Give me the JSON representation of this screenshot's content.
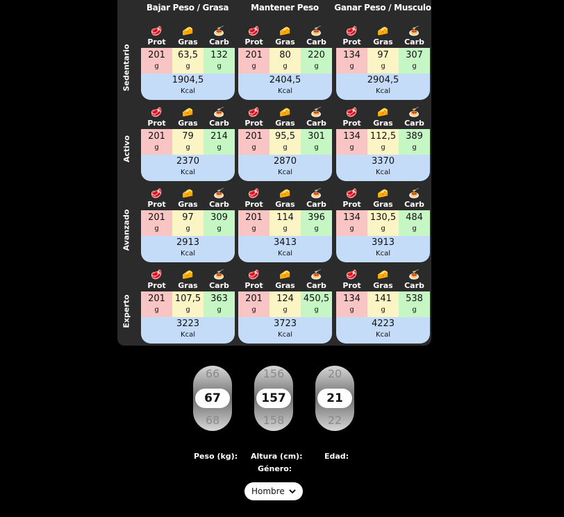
{
  "goals": [
    "Bajar Peso / Grasa",
    "Mantener Peso",
    "Ganar Peso / Musculo"
  ],
  "levels": [
    "Sedentario",
    "Activo",
    "Avanzado",
    "Experto"
  ],
  "macro_labels": {
    "prot": "Prot",
    "fat": "Gras",
    "carb": "Carb"
  },
  "unit_g": "g",
  "unit_kcal": "Kcal",
  "grid": [
    [
      {
        "prot": "201",
        "fat": "63,5",
        "carb": "132",
        "kcal": "1904,5"
      },
      {
        "prot": "201",
        "fat": "80",
        "carb": "220",
        "kcal": "2404,5"
      },
      {
        "prot": "134",
        "fat": "97",
        "carb": "307",
        "kcal": "2904,5"
      }
    ],
    [
      {
        "prot": "201",
        "fat": "79",
        "carb": "214",
        "kcal": "2370"
      },
      {
        "prot": "201",
        "fat": "95,5",
        "carb": "301",
        "kcal": "2870"
      },
      {
        "prot": "134",
        "fat": "112,5",
        "carb": "389",
        "kcal": "3370"
      }
    ],
    [
      {
        "prot": "201",
        "fat": "97",
        "carb": "309",
        "kcal": "2913"
      },
      {
        "prot": "201",
        "fat": "114",
        "carb": "396",
        "kcal": "3413"
      },
      {
        "prot": "134",
        "fat": "130,5",
        "carb": "484",
        "kcal": "3913"
      }
    ],
    [
      {
        "prot": "201",
        "fat": "107,5",
        "carb": "363",
        "kcal": "3223"
      },
      {
        "prot": "201",
        "fat": "124",
        "carb": "450,5",
        "kcal": "3723"
      },
      {
        "prot": "134",
        "fat": "141",
        "carb": "538",
        "kcal": "4223"
      }
    ]
  ],
  "pickers": {
    "weight": {
      "above": "66",
      "value": "67",
      "below": "68",
      "label": "Peso (kg):"
    },
    "height": {
      "above": "156",
      "value": "157",
      "below": "158",
      "label": "Altura (cm):"
    },
    "age": {
      "above": "20",
      "value": "21",
      "below": "22",
      "label": "Edad:"
    }
  },
  "gender": {
    "label": "Género:",
    "value": "Hombre"
  }
}
